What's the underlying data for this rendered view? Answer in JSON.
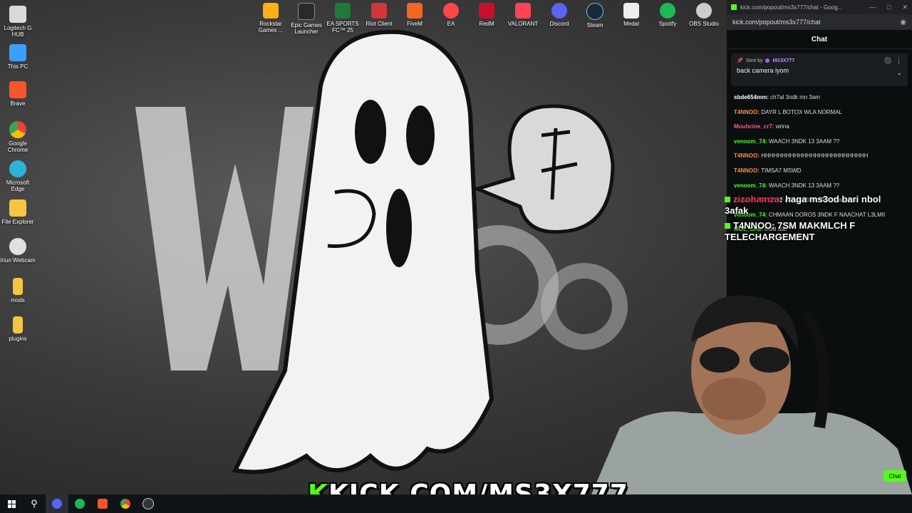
{
  "desktop_icons": [
    {
      "label": "Logitech G HUB",
      "icon": "logitech-icon",
      "color": "#d9d9d9"
    },
    {
      "label": "This PC",
      "icon": "pc-icon",
      "color": "#3aa0ff"
    },
    {
      "label": "Brave",
      "icon": "brave-icon",
      "color": "#fb542b"
    },
    {
      "label": "Google Chrome",
      "icon": "chrome-icon",
      "color": "#34a853"
    },
    {
      "label": "Microsoft Edge",
      "icon": "edge-icon",
      "color": "#2bb4d9"
    },
    {
      "label": "File Explorer",
      "icon": "folder-icon",
      "color": "#f5c542"
    },
    {
      "label": "Iriun Webcam",
      "icon": "webcam-icon",
      "color": "#e0e0e0"
    },
    {
      "label": "mods",
      "icon": "folder-icon",
      "color": "#f5c542"
    },
    {
      "label": "plugins",
      "icon": "folder-icon",
      "color": "#f5c542"
    }
  ],
  "top_icons": [
    {
      "label": "Rockstar Games ...",
      "icon": "rockstar-icon",
      "color": "#fcaf17"
    },
    {
      "label": "Epic Games Launcher",
      "icon": "epic-icon",
      "color": "#2a2a2a"
    },
    {
      "label": "EA SPORTS FC™ 25",
      "icon": "ea-fc-icon",
      "color": "#1f7a3a"
    },
    {
      "label": "Riot Client",
      "icon": "riot-icon",
      "color": "#d13639"
    },
    {
      "label": "FiveM",
      "icon": "fivem-icon",
      "color": "#f26522"
    },
    {
      "label": "EA",
      "icon": "ea-icon",
      "color": "#ff4747"
    },
    {
      "label": "RedM",
      "icon": "redm-icon",
      "color": "#c8102e"
    },
    {
      "label": "VALORANT",
      "icon": "valorant-icon",
      "color": "#fa4454"
    },
    {
      "label": "Discord",
      "icon": "discord-icon",
      "color": "#5865f2"
    },
    {
      "label": "Steam",
      "icon": "steam-icon",
      "color": "#1b2838"
    },
    {
      "label": "Medal",
      "icon": "medal-icon",
      "color": "#eeeeee"
    },
    {
      "label": "Spotify",
      "icon": "spotify-icon",
      "color": "#1db954"
    },
    {
      "label": "OBS Studio",
      "icon": "obs-icon",
      "color": "#cccccc"
    }
  ],
  "taskbar": [
    {
      "icon": "windows-start-icon",
      "color": "#ffffff"
    },
    {
      "icon": "search-icon",
      "color": "#ffffff"
    },
    {
      "icon": "discord-icon",
      "color": "#5865f2"
    },
    {
      "icon": "spotify-icon",
      "color": "#1db954"
    },
    {
      "icon": "brave-icon",
      "color": "#fb542b"
    },
    {
      "icon": "chrome-icon",
      "color": "#ea4335"
    },
    {
      "icon": "obs-icon",
      "color": "#cccccc"
    }
  ],
  "browser": {
    "title": "kick.com/popout/ms3x777/chat - Goog...",
    "url": "kick.com/popout/ms3x777/chat",
    "chat_header": "Chat",
    "pinned": {
      "sent_by_label": "Sent by",
      "sender": "MS3X777",
      "message": "back camera lyom"
    },
    "messages": [
      {
        "user": "sbde654mm:",
        "text": "ch7al 3ndk mn 3am",
        "color": "#ffffff"
      },
      {
        "user": "T4NNOO:",
        "text": "DAYR L BOTOX WLA NORMAL",
        "color": "#ff8a3d"
      },
      {
        "user": "Mouhcine_cr7:",
        "text": "wrina",
        "color": "#ff5c8a"
      },
      {
        "user": "venoom_74:",
        "text": "WAACH 3NDK 13 3AAM ??",
        "color": "#53fc18"
      },
      {
        "user": "T4NNOO:",
        "text": "HHHHHHHHHHHHHHHHHHHHHHHHHH",
        "color": "#ff8a3d"
      },
      {
        "user": "T4NNOO:",
        "text": "TIMSA7 MSWD",
        "color": "#ff8a3d"
      },
      {
        "user": "venoom_74:",
        "text": "WAACH 3NDK 13 3AAM ??",
        "color": "#53fc18"
      },
      {
        "user": "venoom_74:",
        "text": "SAAF ASAAHBII RAAH 20 waheed",
        "color": "#53fc18"
      },
      {
        "user": "venoom_74:",
        "text": "CHMAAN DOROS 3NDK F NAACHAT L3LMII",
        "color": "#53fc18"
      },
      {
        "user": "MOL_CHII:",
        "text": "m9lii fzilt",
        "color": "#53fc18"
      }
    ]
  },
  "overlay_chat": [
    {
      "user": "zizohamza",
      "text": ": haga ms3od bari nbol 3afak"
    },
    {
      "user": "T4NNOO",
      "text": ": 7SM MAKMLCH F TELECHARGEMENT"
    }
  ],
  "kick_banner": {
    "k": "K",
    "text": "KICK.COM/MS3X777"
  },
  "chat_button": "Chat"
}
